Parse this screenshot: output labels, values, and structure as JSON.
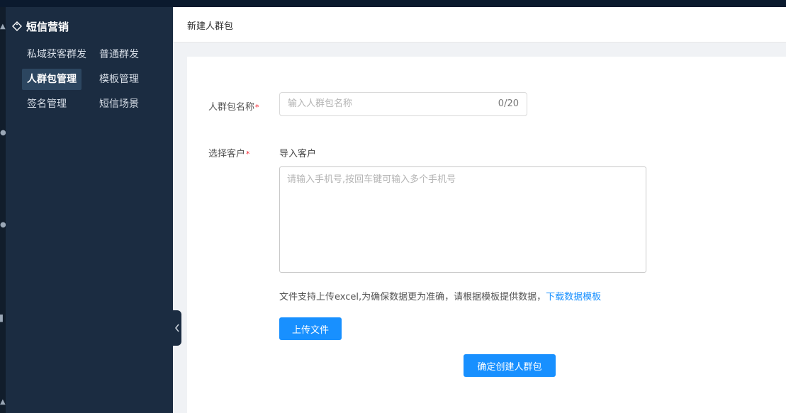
{
  "sidebar": {
    "section_title": "短信营销",
    "items": [
      {
        "label": "私域获客群发"
      },
      {
        "label": "普通群发"
      },
      {
        "label": "人群包管理"
      },
      {
        "label": "模板管理"
      },
      {
        "label": "签名管理"
      },
      {
        "label": "短信场景"
      }
    ],
    "active_item": "人群包管理"
  },
  "breadcrumb": {
    "current": "新建人群包"
  },
  "form": {
    "name_label": "人群包名称",
    "name_placeholder": "输入人群包名称",
    "name_value": "",
    "name_counter": "0/20",
    "customer_label": "选择客户",
    "required_mark": "*",
    "import_label": "导入客户",
    "phones_placeholder": "请输入手机号,按回车键可输入多个手机号",
    "hint_text": "文件支持上传excel,为确保数据更为准确，请根据模板提供数据，",
    "download_link": "下载数据模板",
    "upload_button": "上传文件",
    "submit_button": "确定创建人群包"
  },
  "colors": {
    "sidebar_bg": "#1b2c41",
    "active_item_bg": "#2c4660",
    "primary": "#1890ff",
    "required": "#f5222d"
  }
}
